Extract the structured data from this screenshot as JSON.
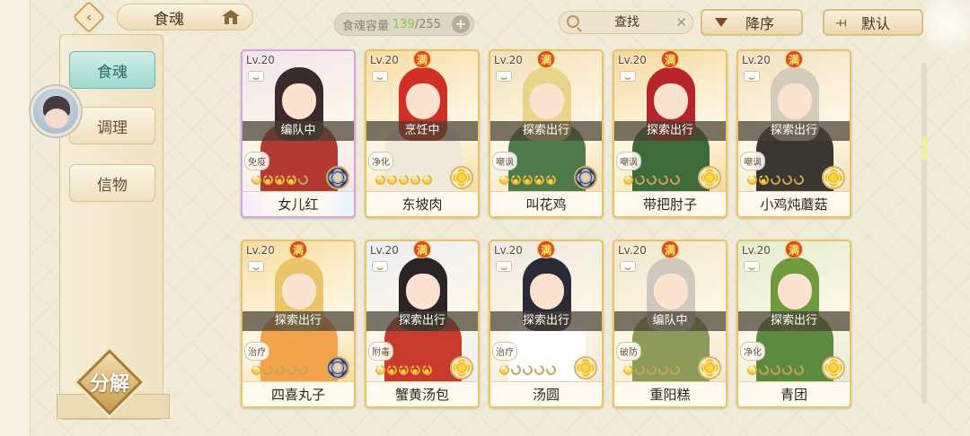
{
  "header": {
    "back_icon": "back-arrow-icon",
    "title": "食魂",
    "home_icon": "home-icon",
    "capacity_label": "食魂容量",
    "capacity_used": "139",
    "capacity_total": "/255",
    "capacity_add": "+",
    "search_placeholder": "查找",
    "search_clear": "✕",
    "sort_order_label": "降序",
    "sort_mode_label": "默认",
    "sort_mode_icon": "⫞⫞"
  },
  "sidebar": {
    "tabs": [
      {
        "label": "食魂",
        "active": true
      },
      {
        "label": "调理",
        "active": false
      },
      {
        "label": "信物",
        "active": false
      }
    ],
    "decompose_label": "分解"
  },
  "cards": [
    {
      "level": "Lv.20",
      "full": "",
      "status": "编队中",
      "role": "免疫",
      "name": "女儿红",
      "stars_gold": 4,
      "fate": "dark",
      "rainbow": true,
      "palette": {
        "bg": "#efe4ee",
        "hair": "#3b2a2c",
        "body": "#b33a32"
      }
    },
    {
      "level": "Lv.20",
      "full": "满",
      "status": "烹饪中",
      "role": "净化",
      "name": "东坡肉",
      "stars_gold": 5,
      "fate": "gold",
      "rainbow": false,
      "palette": {
        "bg": "#f8dca3",
        "hair": "#d22f24",
        "body": "#f0e8da"
      }
    },
    {
      "level": "Lv.20",
      "full": "满",
      "status": "探索出行",
      "role": "嘲讽",
      "name": "叫花鸡",
      "stars_gold": 5,
      "fate": "dark",
      "rainbow": false,
      "palette": {
        "bg": "#f2e0b6",
        "hair": "#e8d48a",
        "body": "#4f7b4c"
      }
    },
    {
      "level": "Lv.20",
      "full": "满",
      "status": "探索出行",
      "role": "嘲讽",
      "name": "带把肘子",
      "stars_gold": 1,
      "fate": "gold",
      "rainbow": false,
      "palette": {
        "bg": "#f5d99b",
        "hair": "#b8242a",
        "body": "#3e6b3a"
      }
    },
    {
      "level": "Lv.20",
      "full": "满",
      "status": "探索出行",
      "role": "嘲讽",
      "name": "小鸡炖蘑菇",
      "stars_gold": 2,
      "fate": "gold",
      "rainbow": false,
      "palette": {
        "bg": "#f1e2bd",
        "hair": "#d2cdbd",
        "body": "#3a3632"
      }
    },
    {
      "level": "Lv.20",
      "full": "满",
      "status": "探索出行",
      "role": "治疗",
      "name": "四喜丸子",
      "stars_gold": 1,
      "fate": "dark",
      "rainbow": false,
      "palette": {
        "bg": "#f7dca0",
        "hair": "#ecc46a",
        "body": "#f2a34c"
      }
    },
    {
      "level": "Lv.20",
      "full": "满",
      "status": "探索出行",
      "role": "附毒",
      "name": "蟹黄汤包",
      "stars_gold": 5,
      "fate": "gold",
      "rainbow": false,
      "palette": {
        "bg": "#e9eef4",
        "hair": "#2a2424",
        "body": "#c83a2c"
      }
    },
    {
      "level": "Lv.20",
      "full": "满",
      "status": "探索出行",
      "role": "治疗",
      "name": "汤圆",
      "stars_gold": 1,
      "fate": "gold",
      "rainbow": false,
      "palette": {
        "bg": "#ede8e0",
        "hair": "#2a2a38",
        "body": "#ffffff"
      }
    },
    {
      "level": "Lv.20",
      "full": "满",
      "status": "编队中",
      "role": "破防",
      "name": "重阳糕",
      "stars_gold": 1,
      "fate": "gold",
      "rainbow": false,
      "palette": {
        "bg": "#efe6cc",
        "hair": "#cfcac0",
        "body": "#8c9a5a"
      }
    },
    {
      "level": "Lv.20",
      "full": "满",
      "status": "探索出行",
      "role": "净化",
      "name": "青团",
      "stars_gold": 1,
      "fate": "gold",
      "rainbow": false,
      "palette": {
        "bg": "#e0ecd0",
        "hair": "#6f9a3e",
        "body": "#5c8b40"
      }
    }
  ]
}
